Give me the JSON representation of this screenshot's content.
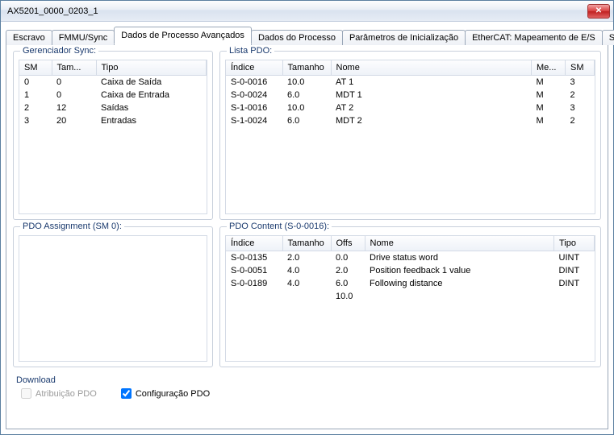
{
  "window": {
    "title": "AX5201_0000_0203_1"
  },
  "tabs": {
    "items": [
      {
        "label": "Escravo"
      },
      {
        "label": "FMMU/Sync"
      },
      {
        "label": "Dados de Processo Avançados"
      },
      {
        "label": "Dados do Processo"
      },
      {
        "label": "Parâmetros de Inicialização"
      },
      {
        "label": "EtherCAT: Mapeamento de E/S"
      },
      {
        "label": "Stat"
      }
    ],
    "activeIndex": 2
  },
  "syncManager": {
    "title": "Gerenciador Sync:",
    "headers": {
      "sm": "SM",
      "tam": "Tam...",
      "tipo": "Tipo"
    },
    "rows": [
      {
        "sm": "0",
        "tam": "0",
        "tipo": "Caixa de Saída"
      },
      {
        "sm": "1",
        "tam": "0",
        "tipo": "Caixa de Entrada"
      },
      {
        "sm": "2",
        "tam": "12",
        "tipo": "Saídas"
      },
      {
        "sm": "3",
        "tam": "20",
        "tipo": "Entradas"
      }
    ]
  },
  "pdoList": {
    "title": "Lista PDO:",
    "headers": {
      "indice": "Índice",
      "tamanho": "Tamanho",
      "nome": "Nome",
      "me": "Me...",
      "sm": "SM"
    },
    "rows": [
      {
        "indice": "S-0-0016",
        "tamanho": "10.0",
        "nome": "AT 1",
        "me": "M",
        "sm": "3"
      },
      {
        "indice": "S-0-0024",
        "tamanho": "6.0",
        "nome": "MDT 1",
        "me": "M",
        "sm": "2"
      },
      {
        "indice": "S-1-0016",
        "tamanho": "10.0",
        "nome": "AT 2",
        "me": "M",
        "sm": "3"
      },
      {
        "indice": "S-1-0024",
        "tamanho": "6.0",
        "nome": "MDT 2",
        "me": "M",
        "sm": "2"
      }
    ]
  },
  "pdoAssignment": {
    "title": "PDO Assignment (SM 0):"
  },
  "pdoContent": {
    "title": "PDO Content (S-0-0016):",
    "headers": {
      "indice": "Índice",
      "tamanho": "Tamanho",
      "offs": "Offs",
      "nome": "Nome",
      "tipo": "Tipo"
    },
    "rows": [
      {
        "indice": "S-0-0135",
        "tamanho": "2.0",
        "offs": "0.0",
        "nome": "Drive status word",
        "tipo": "UINT"
      },
      {
        "indice": "S-0-0051",
        "tamanho": "4.0",
        "offs": "2.0",
        "nome": "Position feedback 1 value",
        "tipo": "DINT"
      },
      {
        "indice": "S-0-0189",
        "tamanho": "4.0",
        "offs": "6.0",
        "nome": "Following distance",
        "tipo": "DINT"
      }
    ],
    "total": "10.0"
  },
  "download": {
    "title": "Download",
    "cbAssign": "Atribuição PDO",
    "cbConfig": "Configuração PDO"
  }
}
